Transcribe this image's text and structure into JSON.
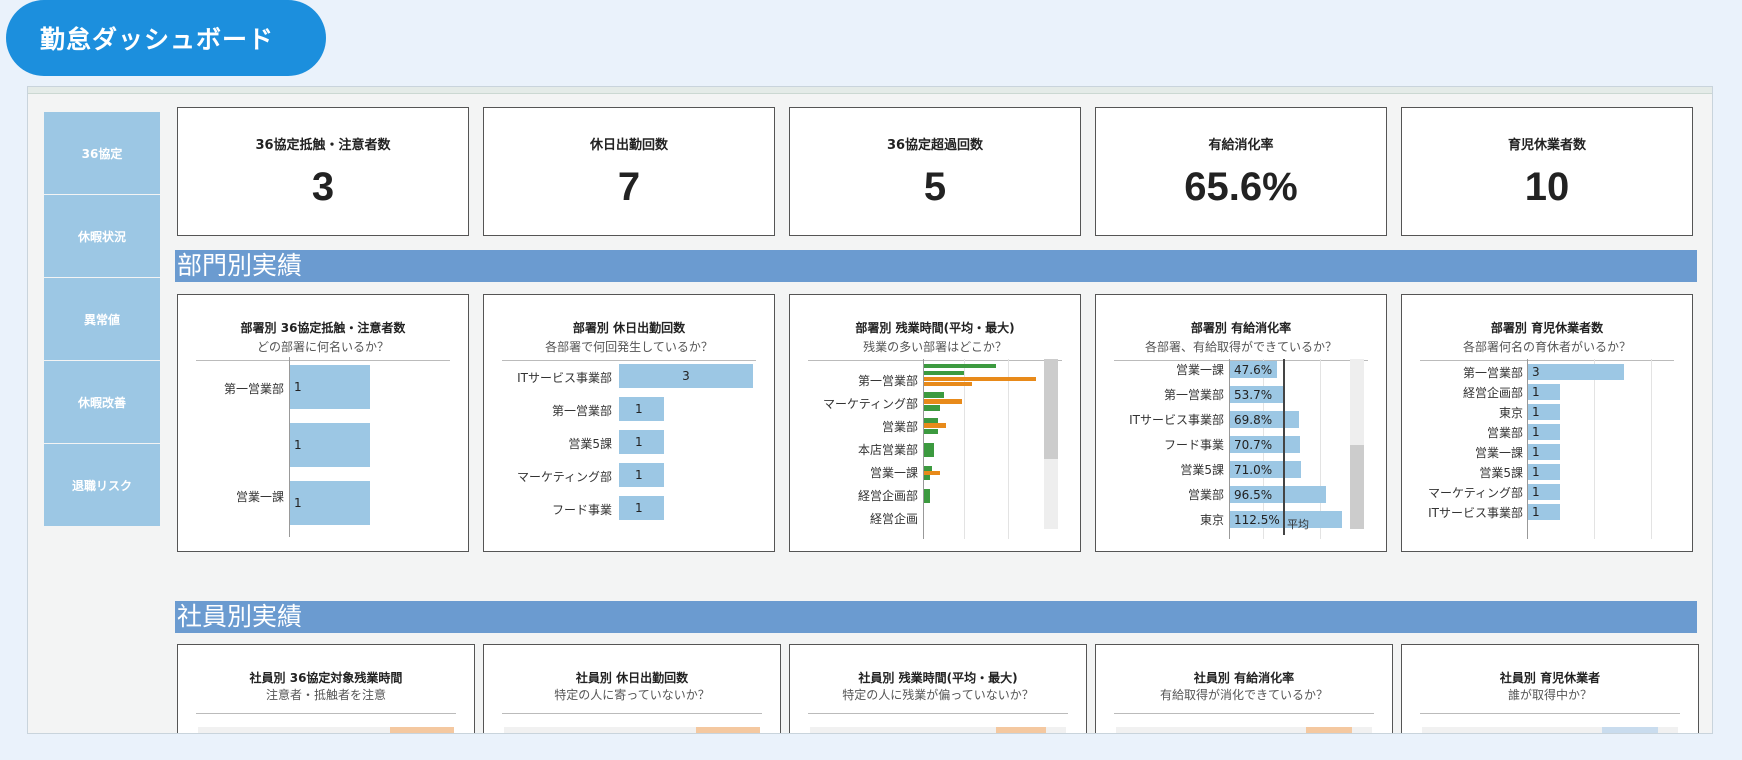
{
  "header": {
    "title": "勤怠ダッシュボード"
  },
  "sidebar": {
    "items": [
      {
        "label": "36協定"
      },
      {
        "label": "休暇状況"
      },
      {
        "label": "異常値"
      },
      {
        "label": "休暇改善"
      },
      {
        "label": "退職リスク"
      }
    ]
  },
  "kpis": [
    {
      "title": "36協定抵触・注意者数",
      "value": "3"
    },
    {
      "title": "休日出勤回数",
      "value": "7"
    },
    {
      "title": "36協定超過回数",
      "value": "5"
    },
    {
      "title": "有給消化率",
      "value": "65.6%"
    },
    {
      "title": "育児休業者数",
      "value": "10"
    }
  ],
  "sections": {
    "dept": "部門別実績",
    "employee": "社員別実績"
  },
  "dept_panels": [
    {
      "title": "部署別 36協定抵触・注意者数",
      "subtitle": "どの部署に何名いるか？",
      "labels": [
        "第一営業部",
        "",
        "営業一課"
      ],
      "values": [
        "1",
        "1",
        "1"
      ]
    },
    {
      "title": "部署別 休日出勤回数",
      "subtitle": "各部署で何回発生しているか？",
      "labels": [
        "ITサービス事業部",
        "第一営業部",
        "営業5課",
        "マーケティング部",
        "フード事業"
      ],
      "values": [
        "3",
        "1",
        "1",
        "1",
        "1"
      ]
    },
    {
      "title": "部署別 残業時間(平均・最大)",
      "subtitle": "残業の多い部署はどこか？",
      "labels": [
        "第一営業部",
        "マーケティング部",
        "営業部",
        "本店営業部",
        "営業一課",
        "経営企画部",
        "経営企画"
      ]
    },
    {
      "title": "部署別 有給消化率",
      "subtitle": "各部署、有給取得ができているか？",
      "labels": [
        "営業一課",
        "第一営業部",
        "ITサービス事業部",
        "フード事業",
        "営業5課",
        "営業部",
        "東京"
      ],
      "values": [
        "47.6%",
        "53.7%",
        "69.8%",
        "70.7%",
        "71.0%",
        "96.5%",
        "112.5%"
      ],
      "avg_label": "平均"
    },
    {
      "title": "部署別 育児休業者数",
      "subtitle": "各部署何名の育休者がいるか？",
      "labels": [
        "第一営業部",
        "経営企画部",
        "東京",
        "営業部",
        "営業一課",
        "営業5課",
        "マーケティング部",
        "ITサービス事業部"
      ],
      "values": [
        "3",
        "1",
        "1",
        "1",
        "1",
        "1",
        "1",
        "1"
      ]
    }
  ],
  "emp_panels": [
    {
      "title": "社員別 36協定対象残業時間",
      "subtitle": "注意者・抵触者を注意"
    },
    {
      "title": "社員別 休日出勤回数",
      "subtitle": "特定の人に寄っていないか？"
    },
    {
      "title": "社員別 残業時間(平均・最大)",
      "subtitle": "特定の人に残業が偏っていないか？"
    },
    {
      "title": "社員別 有給消化率",
      "subtitle": "有給取得が消化できているか？"
    },
    {
      "title": "社員別 育児休業者",
      "subtitle": "誰が取得中か？"
    }
  ],
  "colors": {
    "accent": "#1c8fdd",
    "band": "#6b9bd0",
    "bar": "#9cc7e4",
    "avg_bar": "#3c9a3f",
    "max_bar": "#e88a1a",
    "highlight": "#f4c8a0"
  }
}
